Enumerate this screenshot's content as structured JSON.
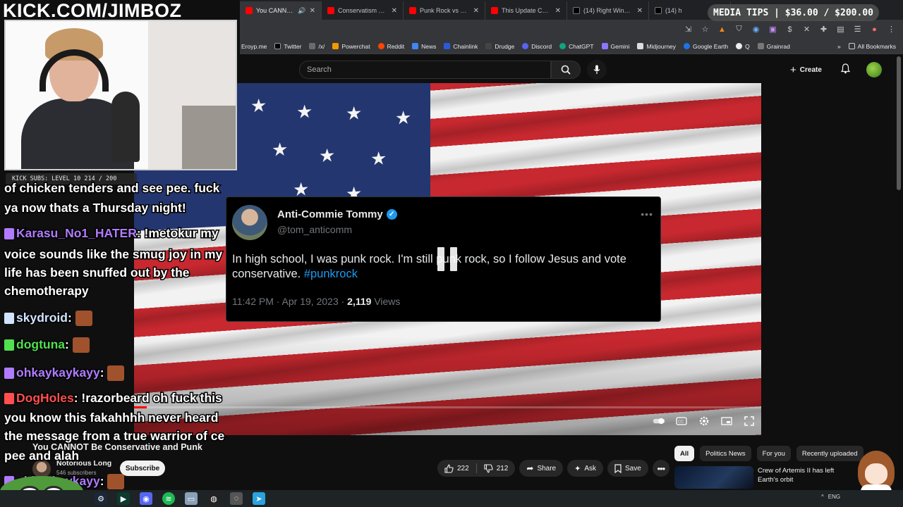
{
  "overlay": {
    "brand": "KICK.COM/JIMBOZ",
    "sub_goal": "KICK SUBS: LEVEL 10 214 / 200",
    "media_tips": "MEDIA TIPS | $36.00 / $200.00"
  },
  "browser": {
    "tabs": [
      {
        "title": "You CANNOT B",
        "favicon": "youtube-icon",
        "active": true
      },
      {
        "title": "Conservatism and",
        "favicon": "youtube-icon",
        "active": false
      },
      {
        "title": "Punk Rock vs Shari",
        "favicon": "youtube-icon",
        "active": false
      },
      {
        "title": "This Update Comp",
        "favicon": "youtube-icon",
        "active": false
      },
      {
        "title": "(14) Right Wing Co",
        "favicon": "x-icon",
        "active": false
      },
      {
        "title": "(14) h",
        "favicon": "x-icon",
        "active": false
      }
    ],
    "bookmarks": [
      {
        "label": "Eroyp.me",
        "color": "#5f6368"
      },
      {
        "label": "Twitter",
        "color": "#000000"
      },
      {
        "label": "/x/",
        "color": "#6b6b6b"
      },
      {
        "label": "Powerchat",
        "color": "#f29900"
      },
      {
        "label": "Reddit",
        "color": "#ff4500"
      },
      {
        "label": "News",
        "color": "#4285f4"
      },
      {
        "label": "Chainlink",
        "color": "#2a5ada"
      },
      {
        "label": "Drudge",
        "color": "#222222"
      },
      {
        "label": "Discord",
        "color": "#5865f2"
      },
      {
        "label": "ChatGPT",
        "color": "#10a37f"
      },
      {
        "label": "Gemini",
        "color": "#8e75ff"
      },
      {
        "label": "Midjourney",
        "color": "#ffffff"
      },
      {
        "label": "Google Earth",
        "color": "#1a73e8"
      },
      {
        "label": "Q",
        "color": "#ffffff"
      },
      {
        "label": "Grainrad",
        "color": "#777777"
      }
    ],
    "all_bookmarks": "All Bookmarks"
  },
  "youtube": {
    "search_placeholder": "Search",
    "create_label": "Create",
    "video_title": "You CANNOT Be Conservative and Punk",
    "channel_name": "Notorious Long",
    "channel_subs": "546 subscribers",
    "subscribe_label": "Subscribe",
    "likes": "222",
    "dislikes": "212",
    "share_label": "Share",
    "ask_label": "Ask",
    "save_label": "Save",
    "chips": [
      "All",
      "Politics News",
      "For you",
      "Recently uploaded"
    ],
    "reco_title": "Crew of Artemis II has left Earth's orbit",
    "progress_fraction": 0.02
  },
  "tweet": {
    "name": "Anti-Commie Tommy",
    "handle": "@tom_anticomm",
    "text": "In high school, I was punk rock. I'm still punk rock, so I follow Jesus and vote conservative.",
    "hashtag": "#punkrock",
    "time": "11:42 PM · Apr 19, 2023 · ",
    "views_count": "2,119",
    "views_label": " Views"
  },
  "chat": [
    {
      "user": "",
      "user_color": "#ffffff",
      "text": "of chicken tenders and see pee. fuck"
    },
    {
      "user": "",
      "user_color": "#ffffff",
      "text": "ya now thats a Thursday night!"
    },
    {
      "user": "Karasu_No1_HATER",
      "user_color": "#b07cff",
      "text": "!metokur my"
    },
    {
      "user": "",
      "user_color": "#ffffff",
      "text": "voice sounds like the smug joy in my"
    },
    {
      "user": "",
      "user_color": "#ffffff",
      "text": "life has been snuffed out by the"
    },
    {
      "user": "",
      "user_color": "#ffffff",
      "text": "chemotherapy"
    },
    {
      "user": "skydroid",
      "user_color": "#d0e4ff",
      "text": ""
    },
    {
      "user": "dogtuna",
      "user_color": "#50e050",
      "text": ""
    },
    {
      "user": "ohkaykaykayy",
      "user_color": "#b07cff",
      "text": ""
    },
    {
      "user": "DogHoles",
      "user_color": "#ff4f4f",
      "text": "!razorbeard oh fuck this"
    },
    {
      "user": "",
      "user_color": "#ffffff",
      "text": "you know this fakahhhh never heard"
    },
    {
      "user": "",
      "user_color": "#ffffff",
      "text": "the message from a true warrior of ce"
    },
    {
      "user": "",
      "user_color": "#ffffff",
      "text": "pee and alah"
    },
    {
      "user": "ohkaykaykayy",
      "user_color": "#b07cff",
      "text": ""
    }
  ],
  "taskbar": {
    "lang": "ENG"
  }
}
